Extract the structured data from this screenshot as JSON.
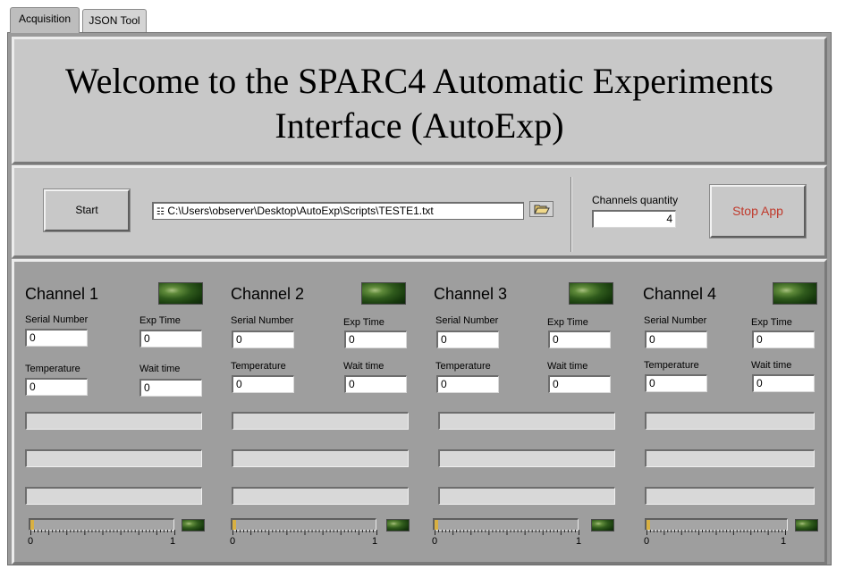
{
  "tabs": [
    {
      "label": "Acquisition",
      "active": true
    },
    {
      "label": "JSON Tool",
      "active": false
    }
  ],
  "header": {
    "title_line1": "Welcome to the SPARC4 Automatic Experiments",
    "title_line2": "Interface (AutoExp)"
  },
  "controls": {
    "start_label": "Start",
    "script_path": "C:\\Users\\observer\\Desktop\\AutoExp\\Scripts\\TESTE1.txt",
    "path_icon": "file-path-icon",
    "browse_icon": "folder-open-icon",
    "channels_quantity_label": "Channels quantity",
    "channels_quantity_value": "4",
    "stop_label": "Stop App",
    "stop_color": "#c0392b"
  },
  "channels": [
    {
      "name": "Channel 1",
      "serial_label": "Serial Number",
      "serial": "0",
      "exp_label": "Exp Time",
      "exp": "0",
      "temp_label": "Temperature",
      "temp": "0",
      "wait_label": "Wait time",
      "wait": "0",
      "progress": 0,
      "scale_min": "0",
      "scale_max": "1"
    },
    {
      "name": "Channel 2",
      "serial_label": "Serial Number",
      "serial": "0",
      "exp_label": "Exp Time",
      "exp": "0",
      "temp_label": "Temperature",
      "temp": "0",
      "wait_label": "Wait time",
      "wait": "0",
      "progress": 0,
      "scale_min": "0",
      "scale_max": "1"
    },
    {
      "name": "Channel 3",
      "serial_label": "Serial Number",
      "serial": "0",
      "exp_label": "Exp Time",
      "exp": "0",
      "temp_label": "Temperature",
      "temp": "0",
      "wait_label": "Wait time",
      "wait": "0",
      "progress": 0,
      "scale_min": "0",
      "scale_max": "1"
    },
    {
      "name": "Channel 4",
      "serial_label": "Serial Number",
      "serial": "0",
      "exp_label": "Exp Time",
      "exp": "0",
      "temp_label": "Temperature",
      "temp": "0",
      "wait_label": "Wait time",
      "wait": "0",
      "progress": 0,
      "scale_min": "0",
      "scale_max": "1"
    }
  ]
}
